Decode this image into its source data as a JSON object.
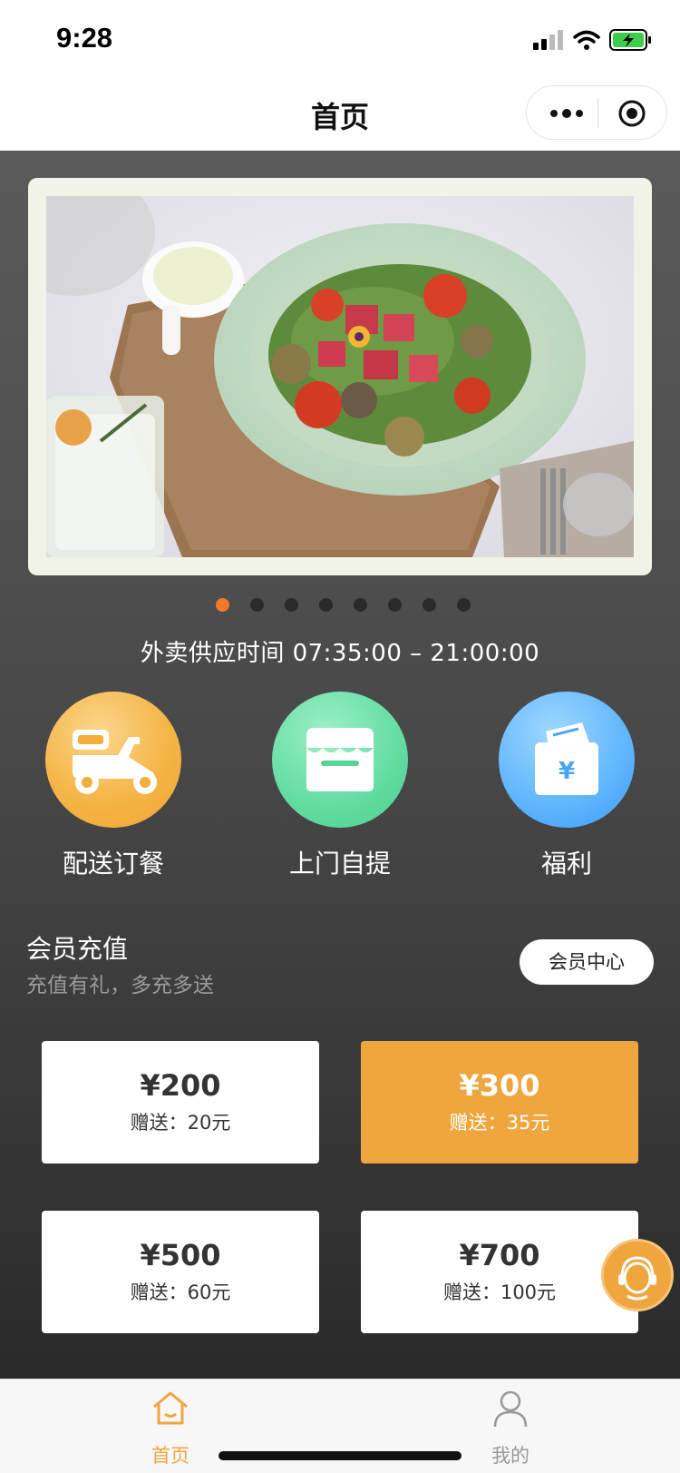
{
  "status_bar": {
    "time": "9:28"
  },
  "nav": {
    "title": "首页"
  },
  "banner": {
    "slide_count": 8,
    "active_index": 0,
    "active_color": "#f07a2b"
  },
  "supply_time": "外卖供应时间 07:35:00 – 21:00:00",
  "services": [
    {
      "label": "配送订餐",
      "icon": "scooter-icon"
    },
    {
      "label": "上门自提",
      "icon": "store-icon"
    },
    {
      "label": "福利",
      "icon": "red-envelope-icon"
    }
  ],
  "member": {
    "title": "会员充值",
    "subtitle": "充值有礼，多充多送",
    "center_button": "会员中心",
    "cards": [
      {
        "amount": "¥200",
        "gift": "赠送：20元",
        "selected": false
      },
      {
        "amount": "¥300",
        "gift": "赠送：35元",
        "selected": true
      },
      {
        "amount": "¥500",
        "gift": "赠送：60元",
        "selected": false
      },
      {
        "amount": "¥700",
        "gift": "赠送：100元",
        "selected": false
      }
    ]
  },
  "tabs": [
    {
      "label": "首页",
      "icon": "home-icon",
      "active": true
    },
    {
      "label": "我的",
      "icon": "user-icon",
      "active": false
    }
  ],
  "colors": {
    "accent": "#f0a63e",
    "dot_active": "#f07a2b"
  }
}
